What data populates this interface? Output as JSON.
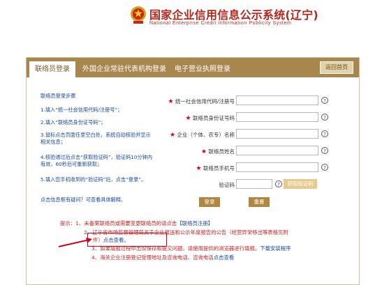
{
  "header": {
    "title": "国家企业信用信息公示系统(辽宁)",
    "subtitle": "National Enterprise Credit Information Publicity System"
  },
  "tabs": [
    {
      "label": "联络员登录",
      "active": true
    },
    {
      "label": "外国企业常驻代表机构登录",
      "active": false
    },
    {
      "label": "电子营业执照登录",
      "active": false
    }
  ],
  "home_button": "返回首页",
  "steps": {
    "title": "联络员登录步骤",
    "items": [
      "1.填入“统一社会信用代码/注册号”；",
      "2.填入“联络员身份证号码”；",
      "3.鼠标点击页面任意空白处，系统自动核验并显示相关信息；",
      "4.核验通过后点击“获取验证码”，验证码10分钟内有效，60秒后可重新获取；",
      "5.填入您手机收到的“验证码”后，点击“登录”。"
    ],
    "faq": "点击信息框有疑问？可查看具体解释。"
  },
  "form": {
    "fields": [
      {
        "label": "统一社会信用代码/注册号",
        "required": true
      },
      {
        "label": "联络员身份证号码",
        "required": true
      },
      {
        "label": "企业（个体、农专）名称",
        "required": true
      },
      {
        "label": "联络员姓名",
        "required": true
      },
      {
        "label": "联络员手机号",
        "required": true
      }
    ],
    "captcha_label": "验证码",
    "get_code_button": "获取验证码",
    "login_button": "登录",
    "reset_button": "重置",
    "help_glyph": "?"
  },
  "tips": {
    "prefix": "提示：",
    "line1": "1、未备案联络员或需要变更联络员的请点击",
    "line1_link": "【联络员注册】",
    "line2": "2、辽宁省市场监督管理局关于企业报送和公示年度报告的公告（经营异常移出等表格见附",
    "line2b": "件）",
    "line2_link": "点击查看。",
    "line3": "3、如果填报过程中出现保存和提交问题，请使用提供的浏览器进行填报。",
    "line3_link": "下载安装程序",
    "line4": "4、海关企业注册登记受理地址及咨询电话、咨询电话",
    "line4_link": "点击查看"
  },
  "colors": {
    "brand_red": "#b5281d",
    "tab_bar": "#a8874f",
    "button_brown": "#b2863f",
    "link_blue": "#1a47a8",
    "tip_red": "#cc1f1f"
  }
}
